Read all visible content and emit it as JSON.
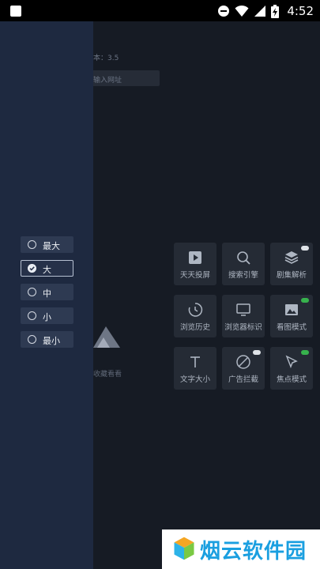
{
  "status_bar": {
    "time": "4:52"
  },
  "home": {
    "version_text": "本：3.5",
    "url_placeholder": "输入网址",
    "empty_hint": "收藏看看"
  },
  "tools": [
    {
      "label": "天天投屏",
      "icon": "cast-play-icon",
      "toggle": null
    },
    {
      "label": "搜索引擎",
      "icon": "search-icon",
      "toggle": null
    },
    {
      "label": "剧集解析",
      "icon": "layers-icon",
      "toggle": "off"
    },
    {
      "label": "浏览历史",
      "icon": "history-clock-icon",
      "toggle": null
    },
    {
      "label": "浏览器标识",
      "icon": "monitor-icon",
      "toggle": null
    },
    {
      "label": "看图模式",
      "icon": "image-icon",
      "toggle": "on"
    },
    {
      "label": "文字大小",
      "icon": "text-size-icon",
      "toggle": null
    },
    {
      "label": "广告拦截",
      "icon": "ad-block-icon",
      "toggle": "off"
    },
    {
      "label": "焦点模式",
      "icon": "cursor-icon",
      "toggle": "on"
    }
  ],
  "font_size_options": [
    {
      "label": "最大",
      "selected": false
    },
    {
      "label": "大",
      "selected": true
    },
    {
      "label": "中",
      "selected": false
    },
    {
      "label": "小",
      "selected": false
    },
    {
      "label": "最小",
      "selected": false
    }
  ],
  "watermark": {
    "text": "烟云软件园"
  },
  "colors": {
    "toggle_on": "#37b24d",
    "toggle_off": "#dfe3e8",
    "drawer_bg": "#1e2940",
    "page_bg": "#161b24"
  }
}
